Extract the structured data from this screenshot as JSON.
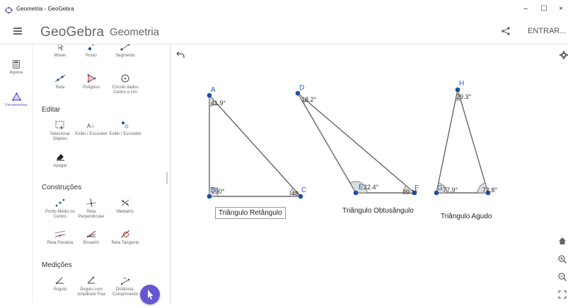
{
  "window": {
    "title": "Geometria - GeoGebra",
    "minimize": "–",
    "maximize": "☐",
    "close": "×"
  },
  "header": {
    "logo": "GeoGebra",
    "app_name": "Geometria",
    "login": "ENTRAR..."
  },
  "nav": {
    "items": [
      {
        "label": "Álgebra",
        "icon": "calculator-icon"
      },
      {
        "label": "Ferramentas",
        "icon": "tools-icon"
      }
    ]
  },
  "tools": {
    "row1": [
      "Mover",
      "Ponto",
      "Segmento"
    ],
    "row2": [
      "Reta",
      "Polígono",
      "Círculo dados Centro e Um"
    ],
    "edit_title": "Editar",
    "edit": [
      "Selecionar Objetos",
      "Exibir / Esconder",
      "Exibir / Esconder"
    ],
    "delete": "Apagar",
    "constr_title": "Construções",
    "constr1": [
      "Ponto Médio ou Centro",
      "Reta Perpendicular",
      "Mediatriz"
    ],
    "constr2": [
      "Reta Paralela",
      "Bissetriz",
      "Reta Tangente"
    ],
    "measure_title": "Medições",
    "measure": [
      "Ângulo",
      "Ângulo com Amplitude Fixa",
      "Distância, Comprimento"
    ]
  },
  "canvas": {
    "points": {
      "A": "A",
      "B": "B",
      "C": "C",
      "D": "D",
      "E": "E",
      "F": "F",
      "G": "G",
      "H": "H"
    },
    "angles": {
      "a": "41.9°",
      "b": "90°",
      "c": "48",
      "d": "18.2°",
      "e": "22.4°",
      "f": "39.1°",
      "g": "77.9°",
      "h": "29.3°",
      "i": "72.8°"
    },
    "captions": {
      "right": "Triângulo Retângulo",
      "obtuse": "Triângulo Obtusângulo",
      "acute": "Triângulo Agudo"
    }
  },
  "colors": {
    "accent": "#6557d2",
    "point": "#1f4fa0",
    "label": "#1f62b8"
  }
}
